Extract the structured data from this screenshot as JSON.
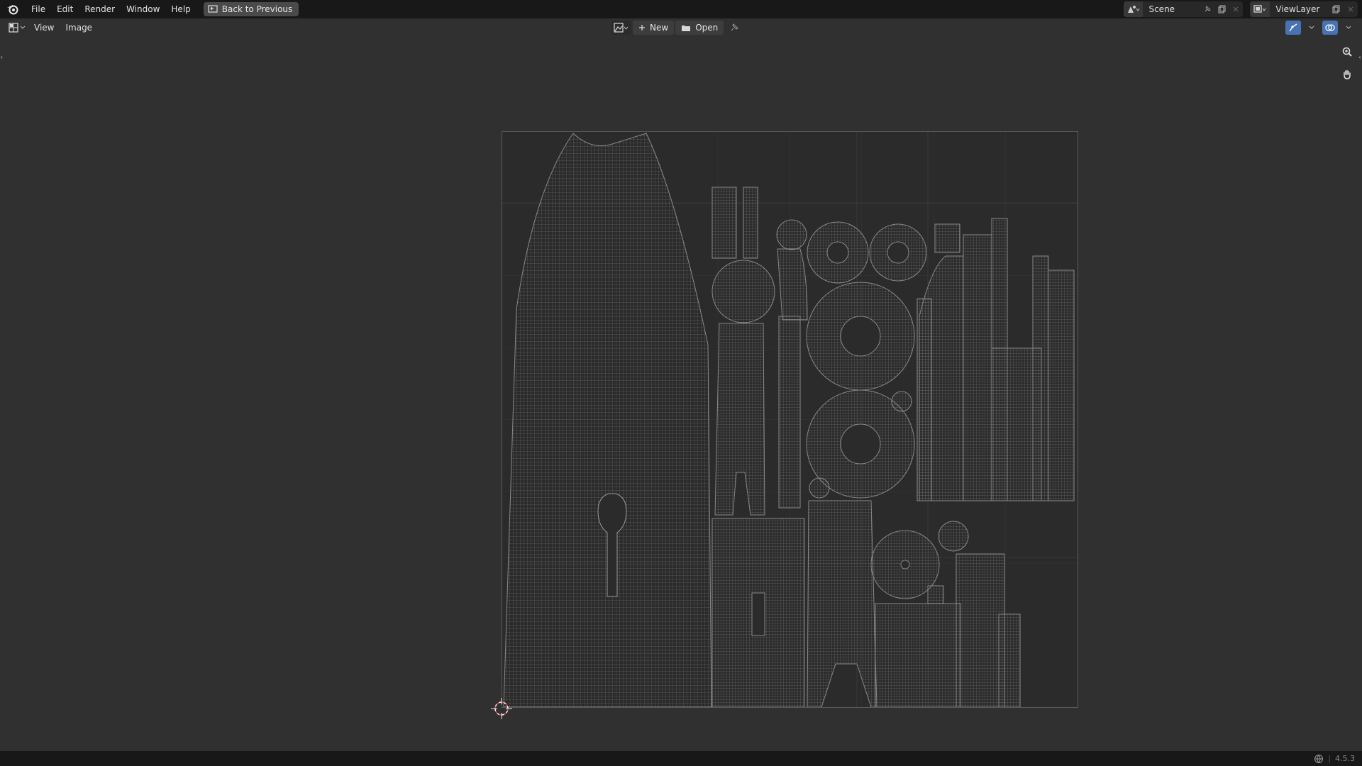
{
  "topbar": {
    "menus": [
      "File",
      "Edit",
      "Render",
      "Window",
      "Help"
    ],
    "back_button": "Back to Previous",
    "scene_label": "Scene",
    "viewlayer_label": "ViewLayer"
  },
  "header": {
    "menus": [
      "View",
      "Image"
    ],
    "new_label": "New",
    "open_label": "Open"
  },
  "status": {
    "version": "4.5.3"
  },
  "icons": {
    "logo": "blender-logo-icon",
    "back": "back-to-previous-icon",
    "scene": "scene-icon",
    "viewlayer": "render-layers-icon",
    "editor_type": "uv-editor-icon",
    "image_browse": "image-browse-icon",
    "new": "plus-icon",
    "open": "folder-icon",
    "pin": "pin-icon",
    "zoom": "zoom-icon",
    "pan": "hand-icon",
    "cursor": "2d-cursor-icon"
  },
  "colors": {
    "topbar_bg": "#181818",
    "editor_bg": "#303030",
    "uv_wire": "#7b7b7b",
    "accent_blue": "#4772b3"
  }
}
